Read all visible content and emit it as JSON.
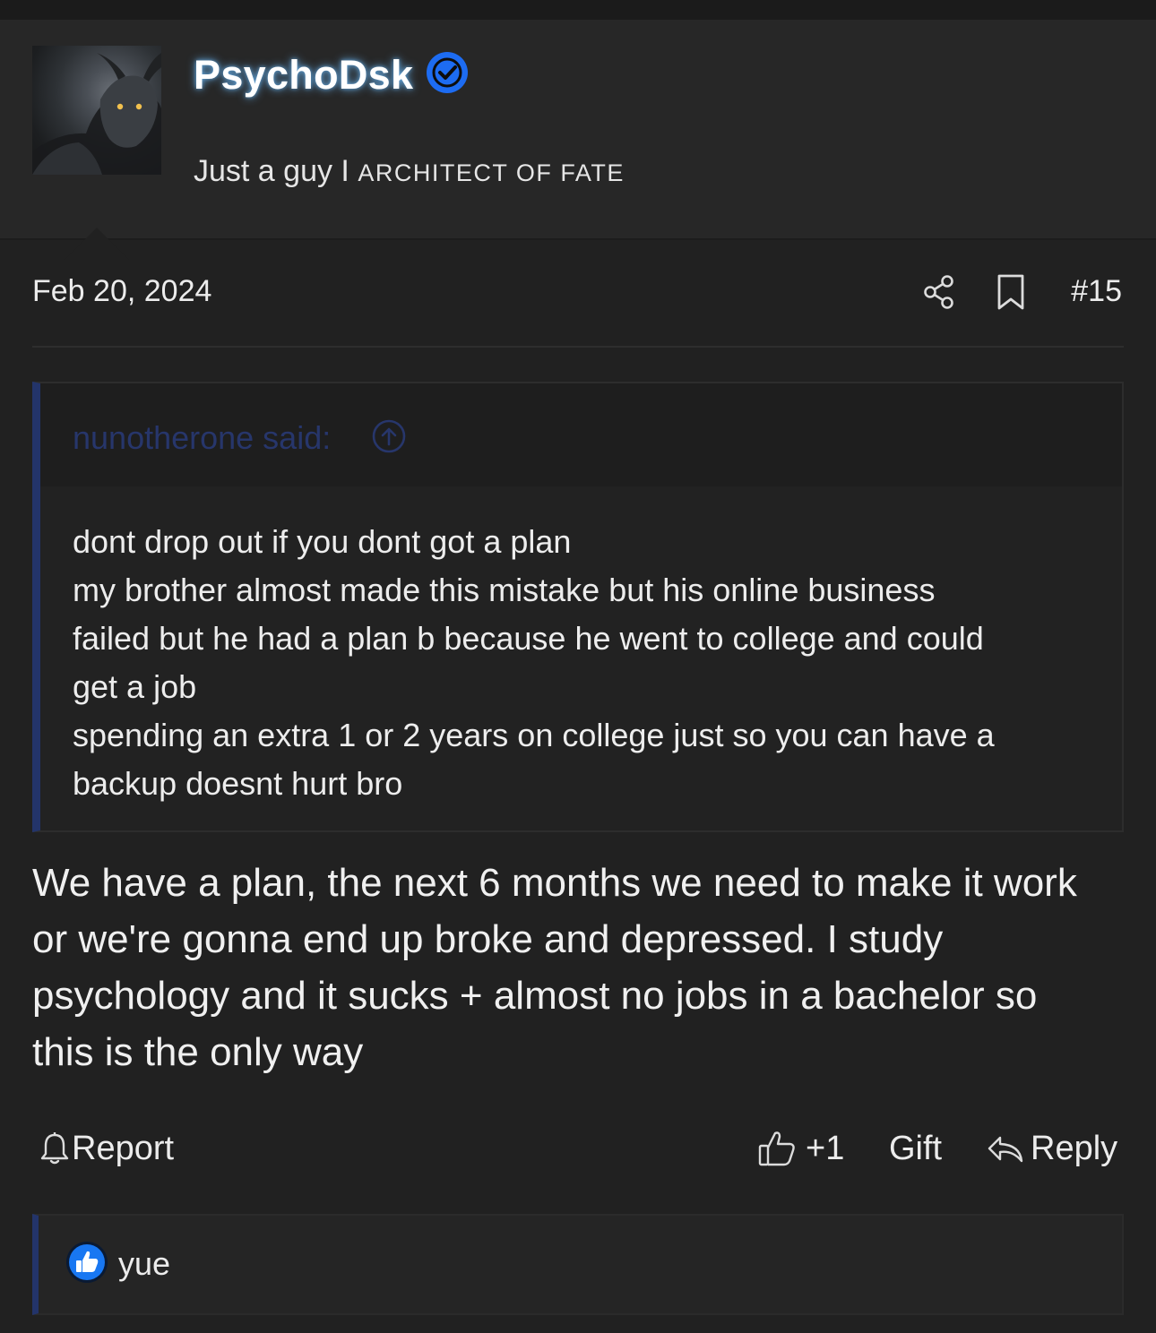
{
  "post": {
    "author": {
      "name": "PsychoDsk",
      "title_prefix": "Just a guy I",
      "title_small": "Architect of Fate"
    },
    "date": "Feb 20, 2024",
    "number": "#15",
    "quote": {
      "author_label": "nunotherone said:",
      "lines": [
        "dont drop out if you dont got a plan",
        "my brother almost made this mistake but his online business",
        "failed but he had a plan b because he went to college and could",
        "get a job",
        "spending an extra 1 or 2 years on college just so you can have a",
        "backup doesnt hurt bro"
      ]
    },
    "message_lines": [
      "We have a plan, the next 6 months we need to make it work",
      "or we're gonna end up broke and depressed. I study",
      "psychology and it sucks + almost no jobs in a bachelor so",
      "this is the only way"
    ],
    "actions": {
      "report": "Report",
      "like": "+1",
      "gift": "Gift",
      "reply": "Reply"
    },
    "reactions": {
      "user": "yue"
    }
  },
  "colors": {
    "background": "#212121",
    "quote_accent": "#23346a",
    "verified": "#1d6cf2",
    "like_badge": "#1877f2"
  },
  "icons": [
    "verified-badge-icon",
    "share-icon",
    "bookmark-icon",
    "arrow-up-circle-icon",
    "bell-icon",
    "thumbs-up-icon",
    "reply-icon",
    "like-reaction-icon"
  ]
}
